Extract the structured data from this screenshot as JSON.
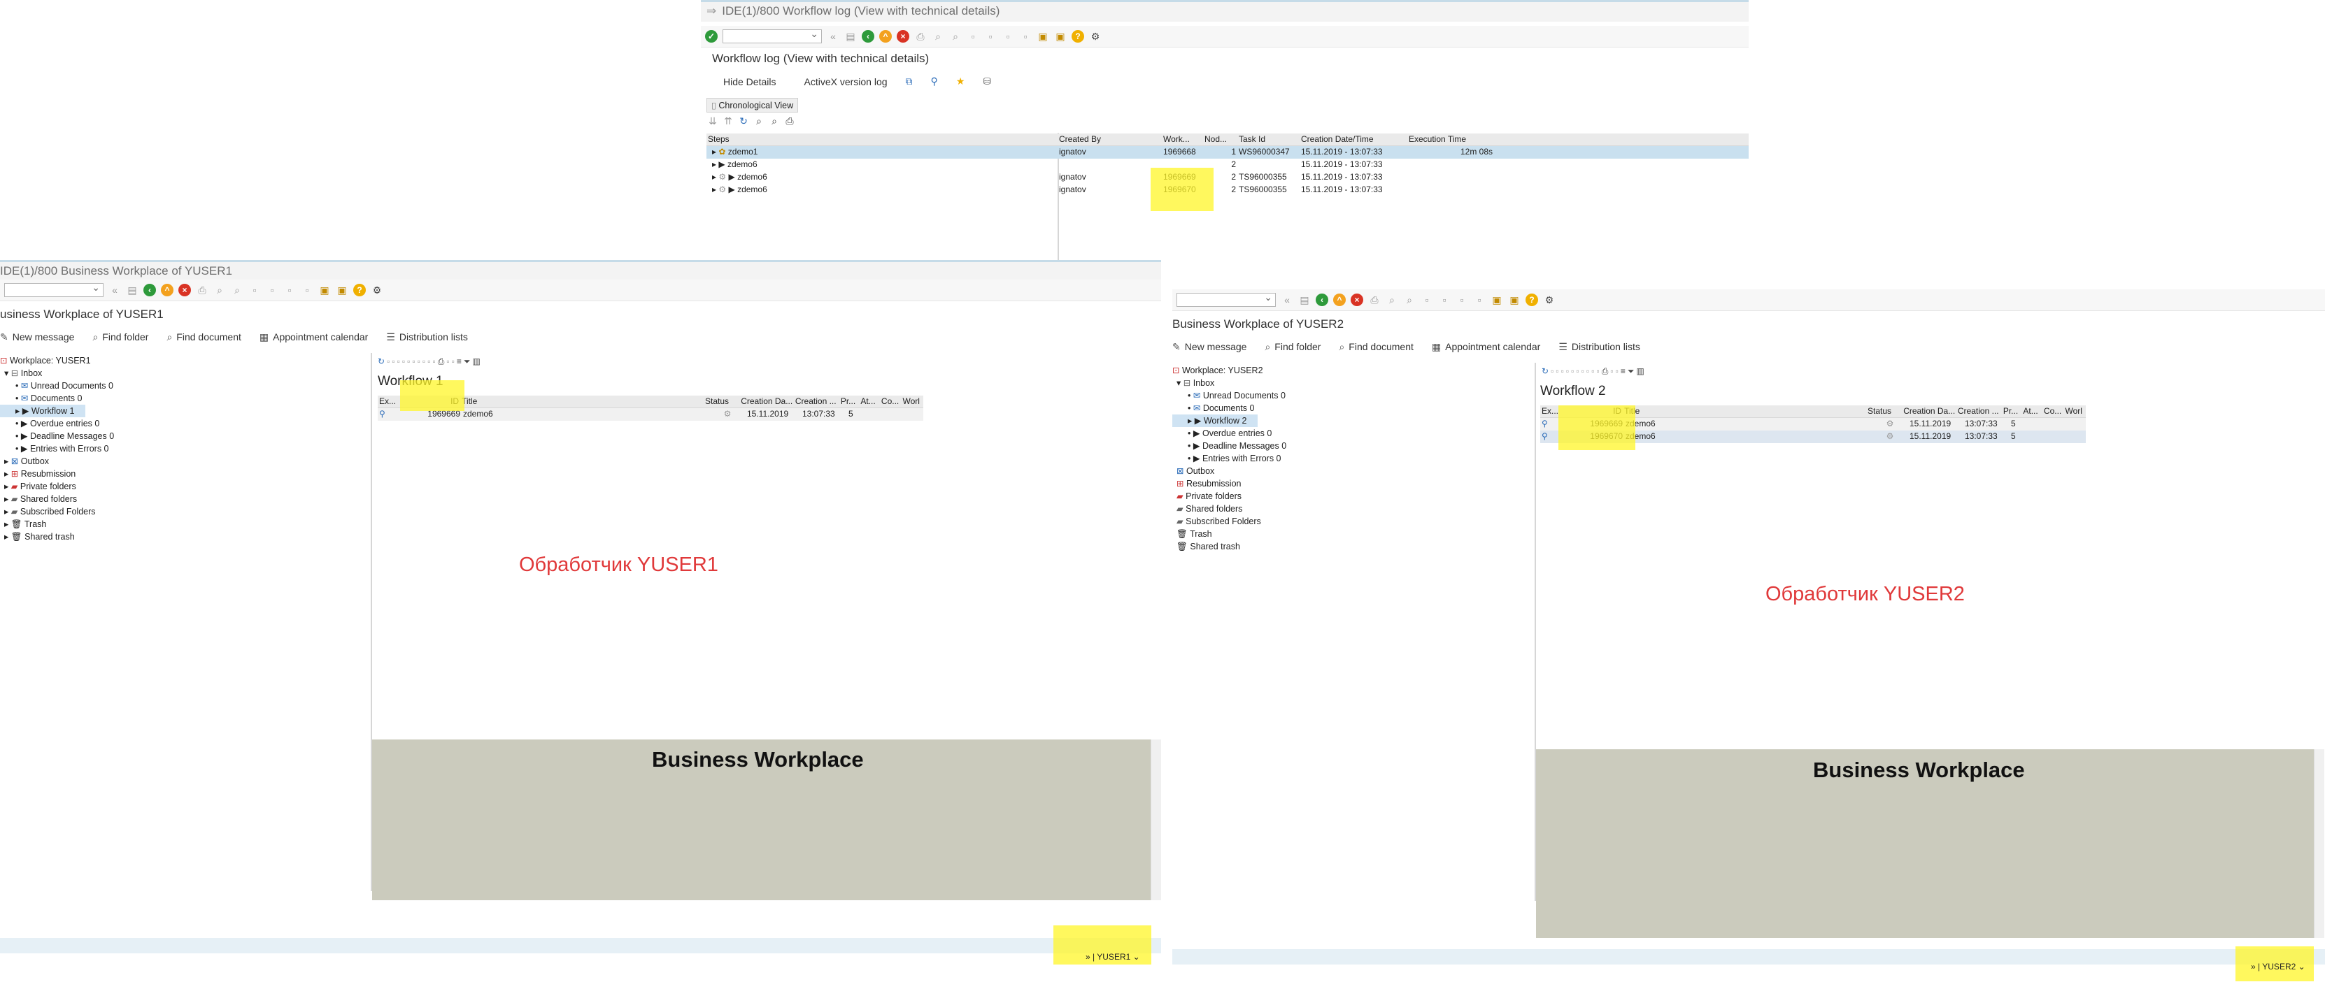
{
  "log": {
    "title": "IDE(1)/800 Workflow log (View with technical details)",
    "heading": "Workflow log (View with technical details)",
    "actions": [
      "Hide Details",
      "ActiveX version log"
    ],
    "tab": "Chronological View",
    "columns": [
      "Steps",
      "Created By",
      "Work...",
      "Nod...",
      "Task Id",
      "Creation Date/Time",
      "Execution Time"
    ],
    "rows": [
      {
        "step": "zdemo1",
        "by": "ignatov",
        "work": "1969668",
        "node": "1",
        "task": "WS96000347",
        "dt": "15.11.2019 - 13:07:33",
        "exec": "12m 08s"
      },
      {
        "step": "zdemo6",
        "by": "",
        "work": "",
        "node": "2",
        "task": "",
        "dt": "15.11.2019 - 13:07:33",
        "exec": ""
      },
      {
        "step": "zdemo6",
        "by": "ignatov",
        "work": "1969669",
        "node": "2",
        "task": "TS96000355",
        "dt": "15.11.2019 - 13:07:33",
        "exec": ""
      },
      {
        "step": "zdemo6",
        "by": "ignatov",
        "work": "1969670",
        "node": "2",
        "task": "TS96000355",
        "dt": "15.11.2019 - 13:07:33",
        "exec": ""
      }
    ]
  },
  "wp1": {
    "title": "IDE(1)/800 Business Workplace of YUSER1",
    "heading": "usiness Workplace of YUSER1",
    "appbar": [
      "New message",
      "Find folder",
      "Find document",
      "Appointment calendar",
      "Distribution lists"
    ],
    "tree_root": "Workplace: YUSER1",
    "tree": [
      "Inbox",
      "Unread Documents 0",
      "Documents 0",
      "Workflow 1",
      "Overdue entries 0",
      "Deadline Messages 0",
      "Entries with Errors 0",
      "Outbox",
      "Resubmission",
      "Private folders",
      "Shared folders",
      "Subscribed Folders",
      "Trash",
      "Shared trash"
    ],
    "list_title": "Workflow 1",
    "columns": [
      "Ex...",
      "ID",
      "Title",
      "Status",
      "Creation Da...",
      "Creation ...",
      "Pr...",
      "At...",
      "Co...",
      "Worl"
    ],
    "rows": [
      {
        "id": "1969669",
        "title": "zdemo6",
        "date": "15.11.2019",
        "time": "13:07:33",
        "pr": "5"
      }
    ],
    "label": "Обработчик YUSER1",
    "panel_title": "Business Workplace",
    "status_user": "YUSER1"
  },
  "wp2": {
    "heading": "Business Workplace of YUSER2",
    "appbar": [
      "New message",
      "Find folder",
      "Find document",
      "Appointment calendar",
      "Distribution lists"
    ],
    "tree_root": "Workplace: YUSER2",
    "tree": [
      "Inbox",
      "Unread Documents 0",
      "Documents 0",
      "Workflow 2",
      "Overdue entries 0",
      "Deadline Messages 0",
      "Entries with Errors 0",
      "Outbox",
      "Resubmission",
      "Private folders",
      "Shared folders",
      "Subscribed Folders",
      "Trash",
      "Shared trash"
    ],
    "list_title": "Workflow 2",
    "columns": [
      "Ex...",
      "ID",
      "Title",
      "Status",
      "Creation Da...",
      "Creation ...",
      "Pr...",
      "At...",
      "Co...",
      "Worl"
    ],
    "rows": [
      {
        "id": "1969669",
        "title": "zdemo6",
        "date": "15.11.2019",
        "time": "13:07:33",
        "pr": "5"
      },
      {
        "id": "1969670",
        "title": "zdemo6",
        "date": "15.11.2019",
        "time": "13:07:33",
        "pr": "5"
      }
    ],
    "label": "Обработчик YUSER2",
    "panel_title": "Business Workplace",
    "status_user": "YUSER2"
  },
  "icons": {
    "ok": "check-circle-icon",
    "help": "question-icon",
    "settings": "gear-icon"
  },
  "colors": {
    "highlight": "#fff528",
    "label_red": "#e0393a",
    "panel_gray": "#cbcbbd"
  }
}
